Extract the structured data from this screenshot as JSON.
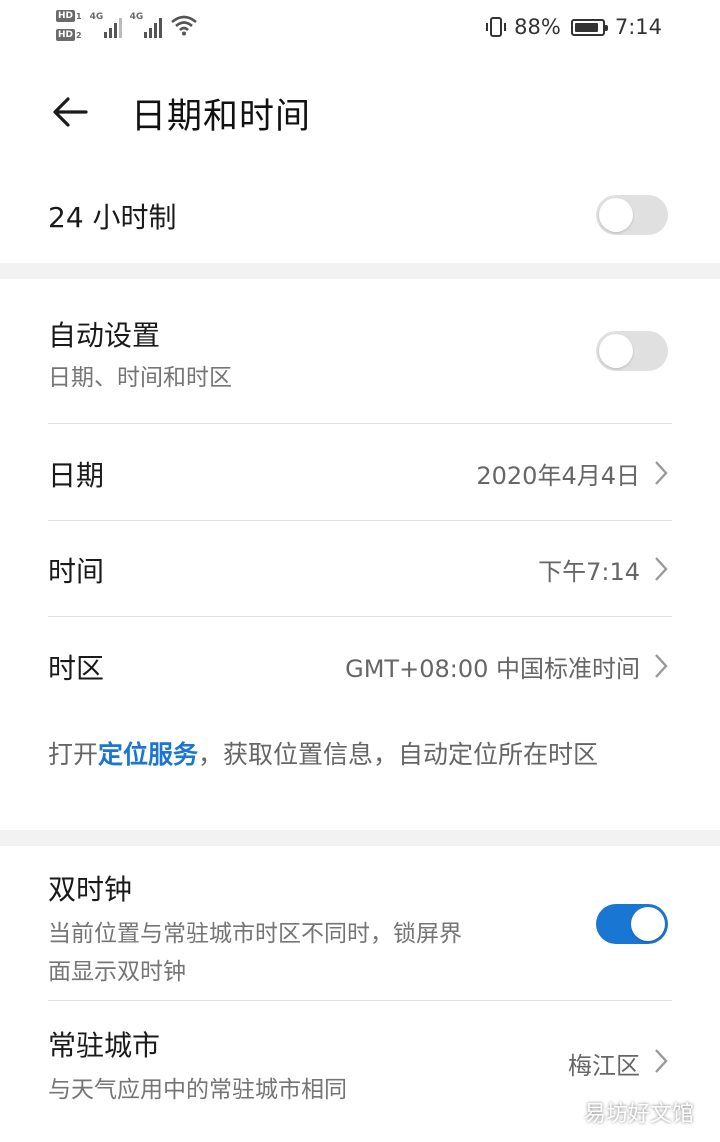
{
  "status_bar": {
    "sim1": "HD",
    "sim1_num": "1",
    "sim2": "HD",
    "sim2_num": "2",
    "net1": "4G",
    "net2": "4G",
    "battery": "88%",
    "battery_level": 0.88,
    "time": "7:14"
  },
  "header": {
    "title": "日期和时间"
  },
  "rows": {
    "hour24": {
      "title": "24 小时制",
      "enabled": false
    },
    "auto": {
      "title": "自动设置",
      "subtitle": "日期、时间和时区",
      "enabled": false
    },
    "date": {
      "title": "日期",
      "value": "2020年4月4日"
    },
    "time": {
      "title": "时间",
      "value": "下午7:14"
    },
    "timezone": {
      "title": "时区",
      "value": "GMT+08:00 中国标准时间"
    },
    "dual_clock": {
      "title": "双时钟",
      "subtitle_line1": "当前位置与常驻城市时区不同时，锁屏界",
      "subtitle_line2": "面显示双时钟",
      "enabled": true
    },
    "home_city": {
      "title": "常驻城市",
      "subtitle": "与天气应用中的常驻城市相同",
      "value": "梅江区"
    }
  },
  "location_info": {
    "prefix": "打开",
    "link": "定位服务",
    "suffix": "，获取位置信息，自动定位所在时区"
  },
  "watermark": "易坊好文馆",
  "colors": {
    "accent": "#1976d2",
    "link": "#1a76d2",
    "toggle_off": "#e0e0e0",
    "divider": "#e3e3e3",
    "band": "#f2f2f2"
  }
}
